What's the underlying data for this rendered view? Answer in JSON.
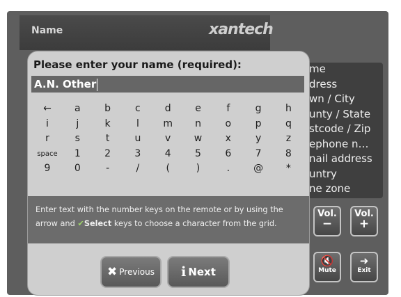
{
  "header": {
    "title": "Name",
    "brand": "xantech"
  },
  "side_fields": [
    "me",
    "dress",
    "wn / City",
    "unty / State",
    "stcode / Zip",
    "ephone n…",
    "nail address",
    "untry",
    "ne zone"
  ],
  "dialog": {
    "prompt": "Please enter your name (required):",
    "input_value": "A.N. Other",
    "keys": [
      [
        "←",
        "a",
        "b",
        "c",
        "d",
        "e",
        "f",
        "g",
        "h"
      ],
      [
        "i",
        "j",
        "k",
        "l",
        "m",
        "n",
        "o",
        "p",
        "q"
      ],
      [
        "r",
        "s",
        "t",
        "u",
        "v",
        "w",
        "x",
        "y",
        "z"
      ],
      [
        "space",
        "1",
        "2",
        "3",
        "4",
        "5",
        "6",
        "7",
        "8"
      ],
      [
        "9",
        "0",
        "-",
        "/",
        "(",
        ")",
        ".",
        "@",
        "*"
      ]
    ],
    "help": {
      "part1": "Enter text with the number keys on the remote or by using the arrow and",
      "check": "✔",
      "select": "Select",
      "part2": "keys to choose a character from the grid."
    },
    "buttons": {
      "previous": {
        "icon": "✖",
        "label": "Previous"
      },
      "next": {
        "icon": "i",
        "label": "Next"
      }
    }
  },
  "controls": {
    "vol_down": {
      "label": "Vol.",
      "icon": "−"
    },
    "vol_up": {
      "label": "Vol.",
      "icon": "+"
    },
    "mute": {
      "label": "Mute",
      "icon": "🔇"
    },
    "exit": {
      "label": "Exit",
      "icon": "➜"
    }
  }
}
